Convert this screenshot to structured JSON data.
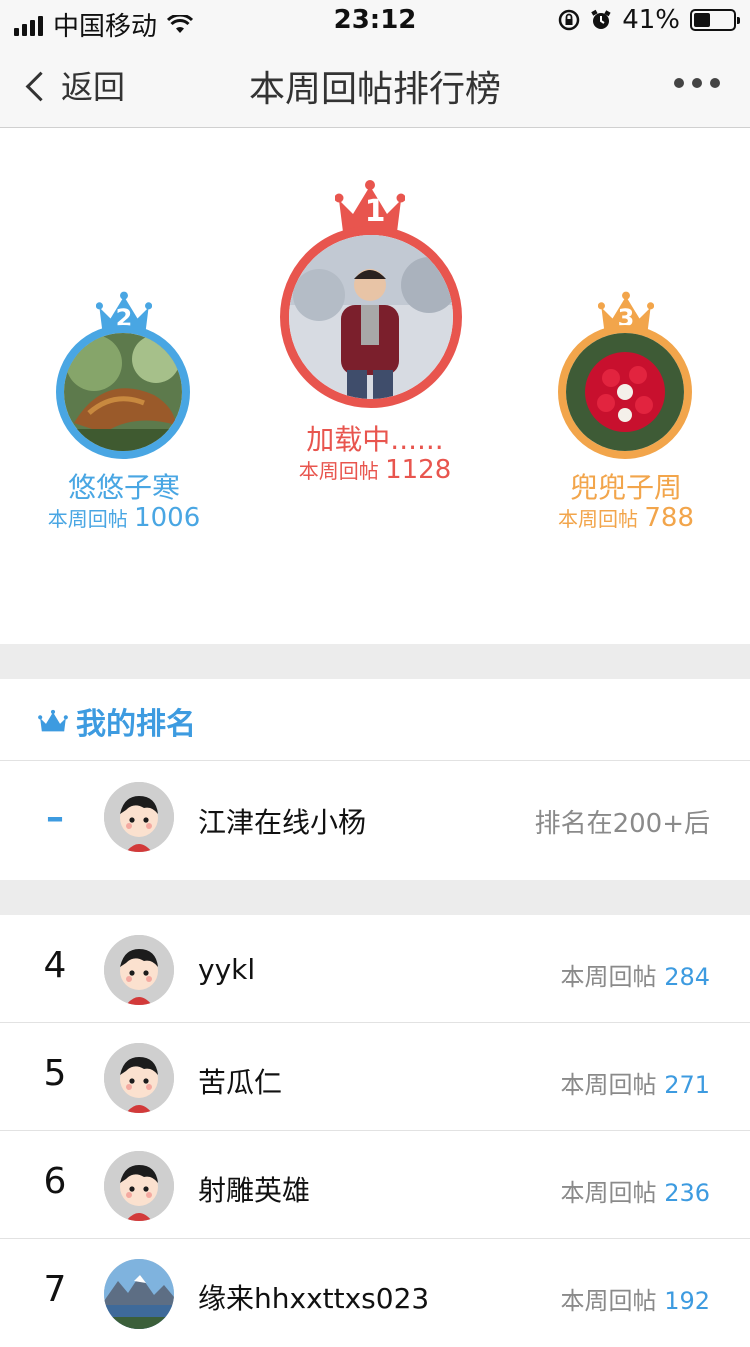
{
  "status_bar": {
    "carrier": "中国移动",
    "time": "23:12",
    "battery_percent": "41%",
    "battery_level": 0.41
  },
  "nav": {
    "back_label": "返回",
    "title": "本周回帖排行榜"
  },
  "podium": [
    {
      "rank": "1",
      "name": "加载中......",
      "count_label": "本周回帖",
      "count": "1128",
      "color": "#e8554e"
    },
    {
      "rank": "2",
      "name": "悠悠子寒",
      "count_label": "本周回帖",
      "count": "1006",
      "color": "#49a6e3"
    },
    {
      "rank": "3",
      "name": "兜兜子周",
      "count_label": "本周回帖",
      "count": "788",
      "color": "#f2a54b"
    }
  ],
  "my_rank": {
    "title": "我的排名",
    "rank": "–",
    "name": "江津在线小杨",
    "status": "排名在200+后"
  },
  "list": [
    {
      "rank": "4",
      "name": "yykl",
      "count_label": "本周回帖",
      "count": "284"
    },
    {
      "rank": "5",
      "name": "苦瓜仁",
      "count_label": "本周回帖",
      "count": "271"
    },
    {
      "rank": "6",
      "name": "射雕英雄",
      "count_label": "本周回帖",
      "count": "236"
    },
    {
      "rank": "7",
      "name": "缘来hhxxttxs023",
      "count_label": "本周回帖",
      "count": "192"
    }
  ],
  "colors": {
    "accent": "#3d9be0",
    "gold": "#e8554e",
    "silver": "#49a6e3",
    "bronze": "#f2a54b"
  }
}
